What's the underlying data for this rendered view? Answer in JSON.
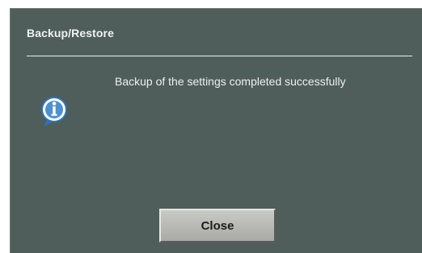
{
  "dialog": {
    "title": "Backup/Restore",
    "message": "Backup of the settings completed successfully",
    "icon": "info-icon",
    "close_label": "Close",
    "colors": {
      "background": "#4f5e5b",
      "text": "#f0f0f0",
      "button": "#b8b9b5"
    }
  }
}
